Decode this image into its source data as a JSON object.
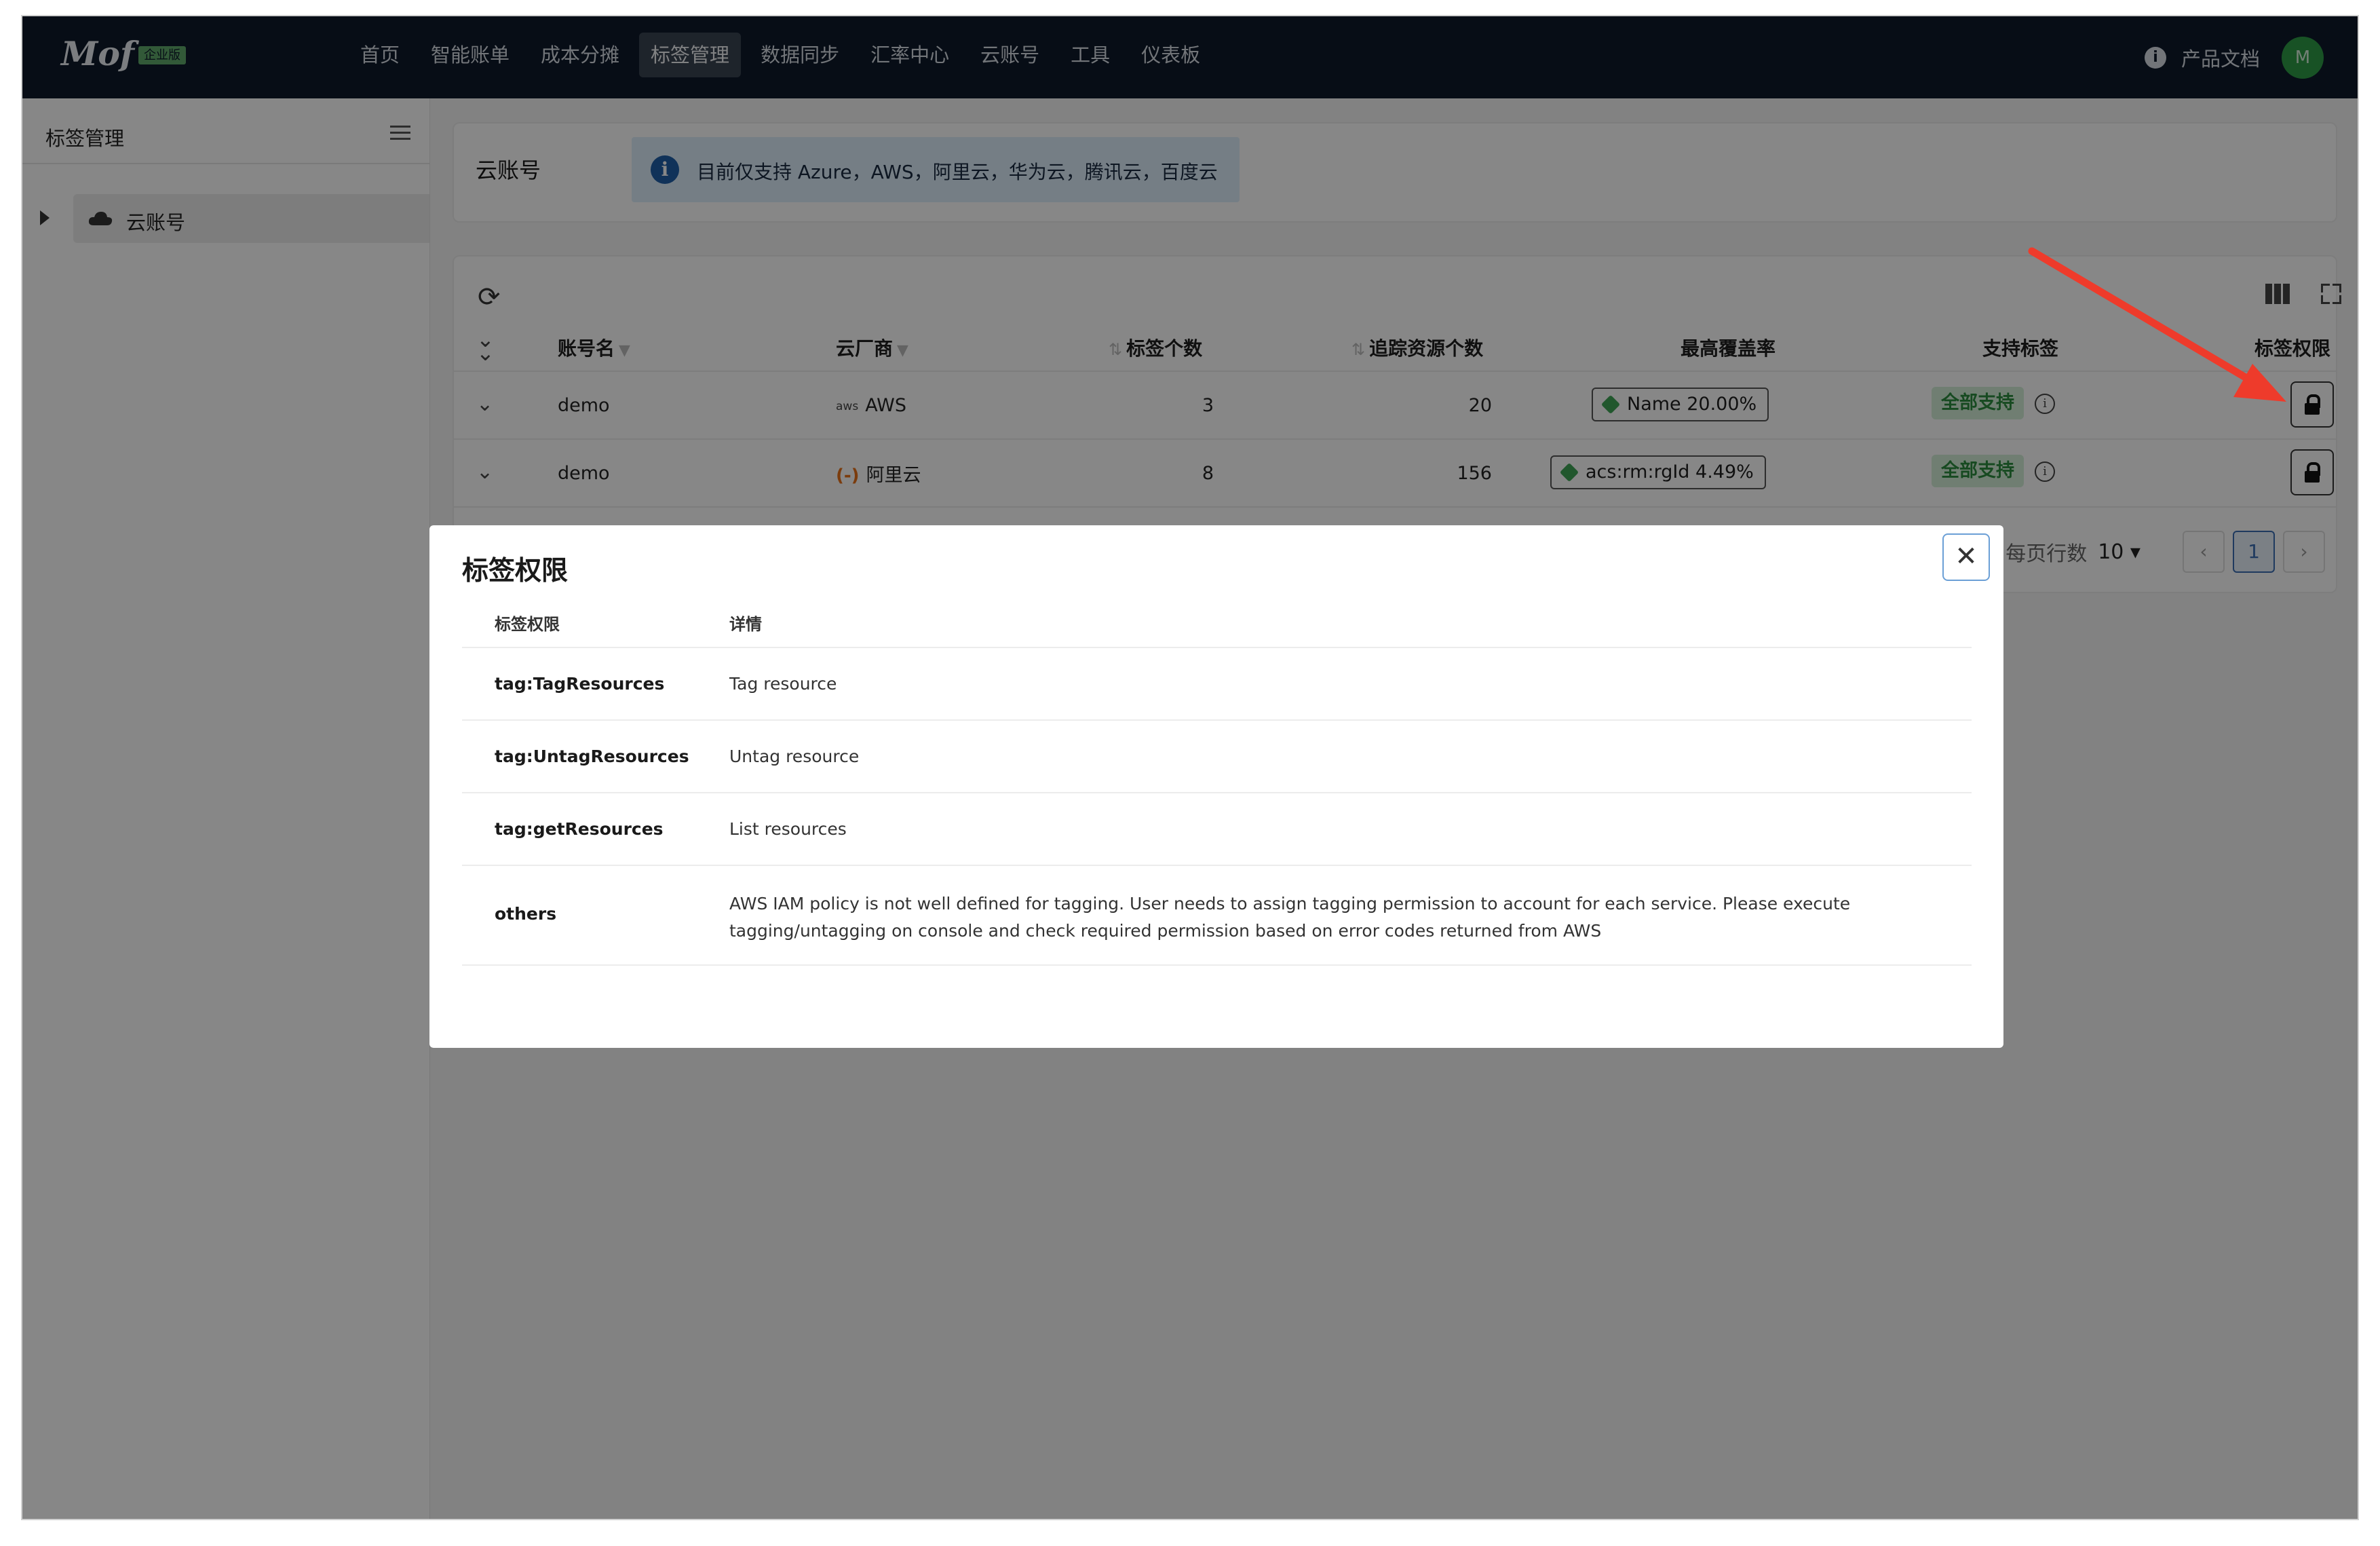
{
  "header": {
    "logo": "Mof",
    "edition": "企业版",
    "nav": [
      "首页",
      "智能账单",
      "成本分摊",
      "标签管理",
      "数据同步",
      "汇率中心",
      "云账号",
      "工具",
      "仪表板"
    ],
    "active_nav": "标签管理",
    "docs_link": "产品文档",
    "avatar_letter": "M"
  },
  "sidebar": {
    "title": "标签管理",
    "tree_node": "云账号"
  },
  "cloud_card": {
    "title": "云账号",
    "alert": "目前仅支持 Azure，AWS，阿里云，华为云，腾讯云，百度云"
  },
  "table": {
    "columns": {
      "account": "账号名",
      "vendor": "云厂商",
      "tag_count": "标签个数",
      "tracked": "追踪资源个数",
      "coverage": "最高覆盖率",
      "support": "支持标签",
      "permission": "标签权限"
    },
    "rows": [
      {
        "account": "demo",
        "vendor_icon_text": "aws",
        "vendor": "AWS",
        "tag_count": "3",
        "tracked": "20",
        "coverage": "Name 20.00%",
        "support": "全部支持"
      },
      {
        "account": "demo",
        "vendor_icon_text": "(-)",
        "vendor": "阿里云",
        "tag_count": "8",
        "tracked": "156",
        "coverage": "acs:rm:rgId 4.49%",
        "support": "全部支持"
      }
    ],
    "pager": {
      "label": "每页行数",
      "size": "10",
      "page": "1"
    }
  },
  "modal": {
    "title": "标签权限",
    "head": {
      "perm": "标签权限",
      "detail": "详情"
    },
    "rows": [
      {
        "perm": "tag:TagResources",
        "detail": "Tag resource"
      },
      {
        "perm": "tag:UntagResources",
        "detail": "Untag resource"
      },
      {
        "perm": "tag:getResources",
        "detail": "List resources"
      },
      {
        "perm": "others",
        "detail": "AWS IAM policy is not well defined for tagging. User needs to assign tagging permission to account for each service. Please execute tagging/untagging on console and check required permission based on error codes returned from AWS"
      }
    ]
  },
  "colors": {
    "header_bg": "#0e1a2b",
    "badge_green": "#2c8d3f",
    "arrow_red": "#ee3b2b",
    "alert_bg": "#ddeefb"
  }
}
